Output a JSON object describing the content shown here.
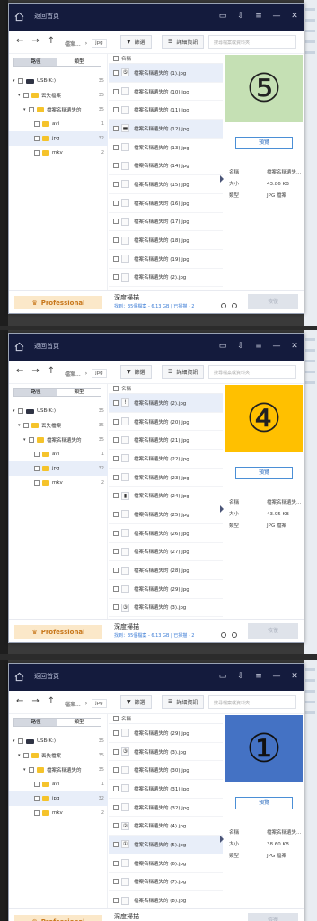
{
  "app": {
    "title": "返回首頁",
    "breadcrumb_root": "檔案...",
    "breadcrumb_current": "jpg",
    "filter_label": "篩選",
    "details_label": "詳細資訊",
    "search_placeholder": "搜尋檔案或資料夾",
    "tab_path": "路徑",
    "tab_type": "類型",
    "column_name": "名稱",
    "preview_label": "預覽",
    "info_name_key": "名稱",
    "info_size_key": "大小",
    "info_type_key": "類型",
    "info_name_value": "檔案名稱遺失...",
    "info_type_value": "JPG 檔案",
    "professional_label": "Professional",
    "deep_scan_label": "深度掃描",
    "found_text": "找到：35個檔案 - 6.13 GB | 已掃描 - 2",
    "recover_label": "恢復"
  },
  "panels": [
    {
      "tree": [
        {
          "label": "USB(K:)",
          "count": "35"
        },
        {
          "label": "丟失檔案",
          "count": "35"
        },
        {
          "label": "檔案名稱遺失的",
          "count": "35"
        },
        {
          "label": "avi",
          "count": "1"
        },
        {
          "label": "jpg",
          "count": "32"
        },
        {
          "label": "mkv",
          "count": "2"
        }
      ],
      "files": [
        {
          "name": "檔案名稱遺失的 (1).jpg",
          "thumb": "⑤",
          "selected": true
        },
        {
          "name": "檔案名稱遺失的 (10).jpg",
          "thumb": ""
        },
        {
          "name": "檔案名稱遺失的 (11).jpg",
          "thumb": ""
        },
        {
          "name": "檔案名稱遺失的 (12).jpg",
          "thumb": "▬",
          "highlight": true
        },
        {
          "name": "檔案名稱遺失的 (13).jpg",
          "thumb": ""
        },
        {
          "name": "檔案名稱遺失的 (14).jpg",
          "thumb": ""
        },
        {
          "name": "檔案名稱遺失的 (15).jpg",
          "thumb": ""
        },
        {
          "name": "檔案名稱遺失的 (16).jpg",
          "thumb": ""
        },
        {
          "name": "檔案名稱遺失的 (17).jpg",
          "thumb": ""
        },
        {
          "name": "檔案名稱遺失的 (18).jpg",
          "thumb": ""
        },
        {
          "name": "檔案名稱遺失的 (19).jpg",
          "thumb": ""
        },
        {
          "name": "檔案名稱遺失的 (2).jpg",
          "thumb": ""
        }
      ],
      "preview_symbol": "⑤",
      "preview_bg": "#c5e0b4",
      "size_value": "43.86 KB"
    },
    {
      "tree": [
        {
          "label": "USB(K:)",
          "count": "35"
        },
        {
          "label": "丟失檔案",
          "count": "35"
        },
        {
          "label": "檔案名稱遺失的",
          "count": "35"
        },
        {
          "label": "avi",
          "count": "1"
        },
        {
          "label": "jpg",
          "count": "32"
        },
        {
          "label": "mkv",
          "count": "2"
        }
      ],
      "files": [
        {
          "name": "檔案名稱遺失的 (2).jpg",
          "thumb": "!",
          "selected": true
        },
        {
          "name": "檔案名稱遺失的 (20).jpg",
          "thumb": ""
        },
        {
          "name": "檔案名稱遺失的 (21).jpg",
          "thumb": ""
        },
        {
          "name": "檔案名稱遺失的 (22).jpg",
          "thumb": ""
        },
        {
          "name": "檔案名稱遺失的 (23).jpg",
          "thumb": ""
        },
        {
          "name": "檔案名稱遺失的 (24).jpg",
          "thumb": "▮"
        },
        {
          "name": "檔案名稱遺失的 (25).jpg",
          "thumb": ""
        },
        {
          "name": "檔案名稱遺失的 (26).jpg",
          "thumb": ""
        },
        {
          "name": "檔案名稱遺失的 (27).jpg",
          "thumb": ""
        },
        {
          "name": "檔案名稱遺失的 (28).jpg",
          "thumb": ""
        },
        {
          "name": "檔案名稱遺失的 (29).jpg",
          "thumb": ""
        },
        {
          "name": "檔案名稱遺失的 (3).jpg",
          "thumb": "③"
        }
      ],
      "preview_symbol": "④",
      "preview_bg": "#ffc000",
      "size_value": "43.95 KB"
    },
    {
      "tree": [
        {
          "label": "USB(K:)",
          "count": "35"
        },
        {
          "label": "丟失檔案",
          "count": "35"
        },
        {
          "label": "檔案名稱遺失的",
          "count": "35"
        },
        {
          "label": "avi",
          "count": "1"
        },
        {
          "label": "jpg",
          "count": "32"
        },
        {
          "label": "mkv",
          "count": "2"
        }
      ],
      "files": [
        {
          "name": "檔案名稱遺失的 (29).jpg",
          "thumb": ""
        },
        {
          "name": "檔案名稱遺失的 (3).jpg",
          "thumb": "③"
        },
        {
          "name": "檔案名稱遺失的 (30).jpg",
          "thumb": ""
        },
        {
          "name": "檔案名稱遺失的 (31).jpg",
          "thumb": ""
        },
        {
          "name": "檔案名稱遺失的 (32).jpg",
          "thumb": ""
        },
        {
          "name": "檔案名稱遺失的 (4).jpg",
          "thumb": "②"
        },
        {
          "name": "檔案名稱遺失的 (5).jpg",
          "thumb": "①",
          "selected": true
        },
        {
          "name": "檔案名稱遺失的 (6).jpg",
          "thumb": ""
        },
        {
          "name": "檔案名稱遺失的 (7).jpg",
          "thumb": ""
        },
        {
          "name": "檔案名稱遺失的 (8).jpg",
          "thumb": ""
        }
      ],
      "preview_symbol": "①",
      "preview_bg": "#4472c4",
      "size_value": "38.60 KB"
    }
  ]
}
